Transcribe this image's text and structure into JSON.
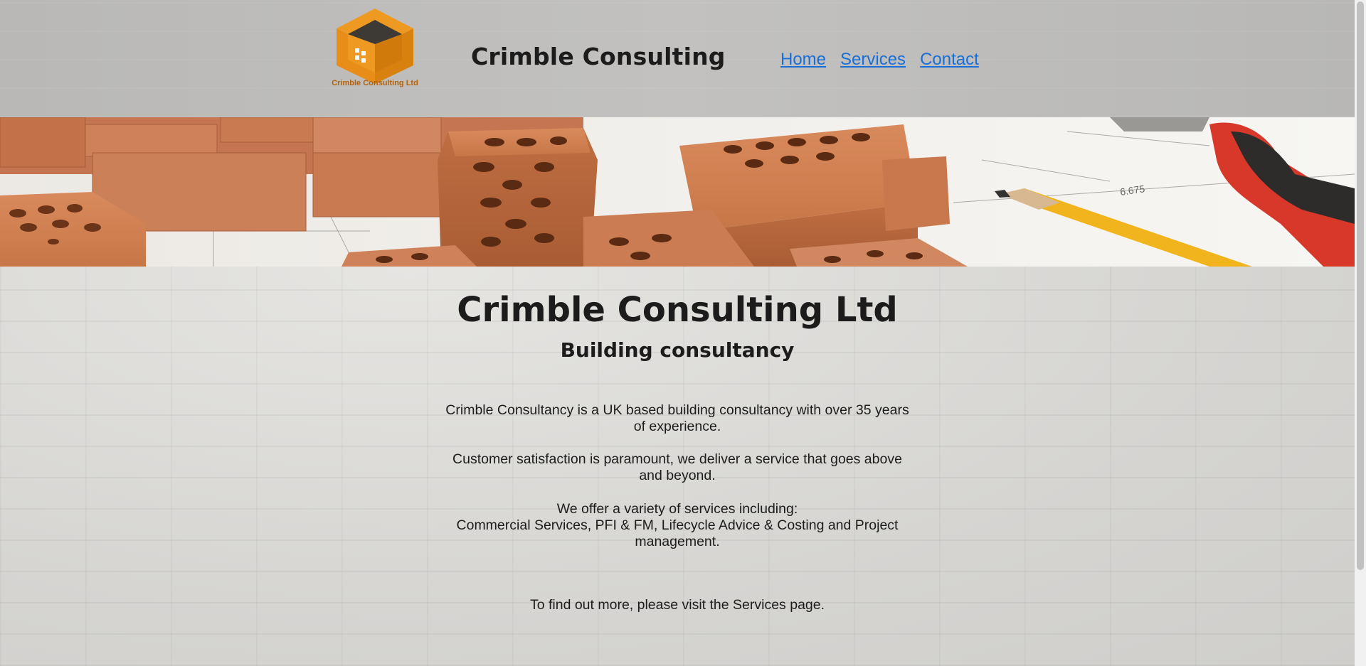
{
  "header": {
    "logo_text": "Crimble Consulting Ltd",
    "site_title": "Crimble Consulting",
    "nav": {
      "home": "Home",
      "services": "Services",
      "contact": "Contact"
    }
  },
  "main": {
    "title": "Crimble Consulting Ltd",
    "subtitle": "Building consultancy",
    "paragraph_1": "Crimble Consultancy is a UK based building consultancy with over 35 years of experience.",
    "paragraph_2": "Customer satisfaction is paramount, we deliver a service that goes above and beyond.",
    "paragraph_3_intro": "We offer a variety of services including:",
    "paragraph_3_list": "Commercial Services, PFI & FM, Lifecycle Advice & Costing and Project management.",
    "paragraph_4": "To find out more, please visit the Services page."
  },
  "colors": {
    "brand_orange": "#ee9a22",
    "brand_dark": "#3d3a35",
    "link": "#1a6fd6",
    "brick": "#c97a4e"
  },
  "icons": {
    "logo": "cube-house-logo-icon"
  }
}
